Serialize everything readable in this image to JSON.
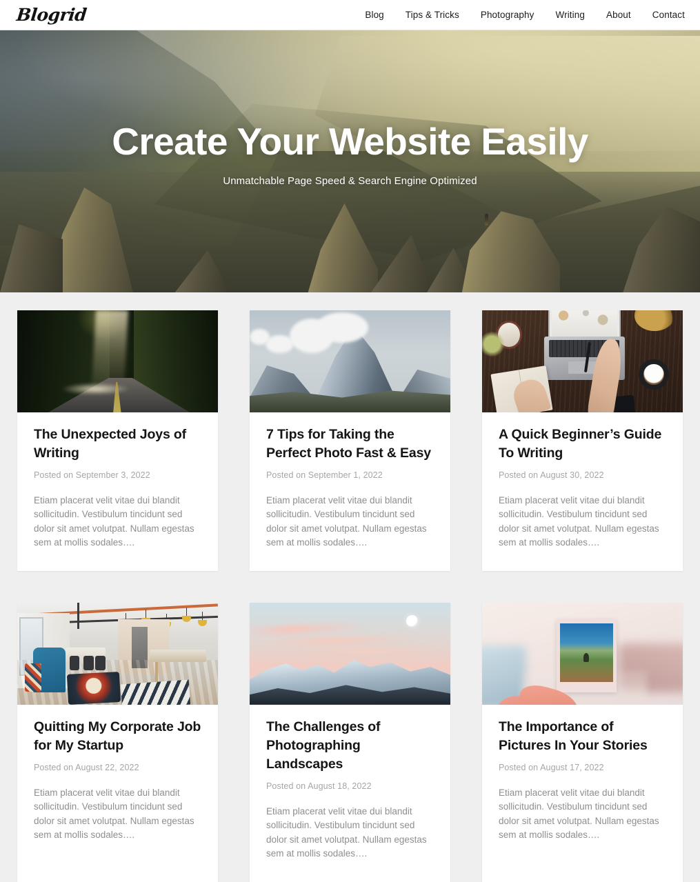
{
  "header": {
    "logo": "Blogrid",
    "nav": [
      {
        "label": "Blog"
      },
      {
        "label": "Tips & Tricks"
      },
      {
        "label": "Photography"
      },
      {
        "label": "Writing"
      },
      {
        "label": "About"
      },
      {
        "label": "Contact"
      }
    ]
  },
  "hero": {
    "title": "Create Your Website Easily",
    "subtitle": "Unmatchable Page Speed & Search Engine Optimized",
    "image_alt": "mountain-valley-landscape-with-rock-spires-and-hiker"
  },
  "posts": [
    {
      "title": "The Unexpected Joys of Writing",
      "date": "Posted on September 3, 2022",
      "excerpt": "Etiam placerat velit vitae dui blandit sollicitudin. Vestibulum tincidunt sed dolor sit amet volutpat. Nullam egestas sem at mollis sodales….",
      "image_alt": "sunbeam-on-forest-road"
    },
    {
      "title": "7 Tips for Taking the Perfect Photo Fast & Easy",
      "date": "Posted on September 1, 2022",
      "excerpt": "Etiam placerat velit vitae dui blandit sollicitudin. Vestibulum tincidunt sed dolor sit amet volutpat. Nullam egestas sem at mollis sodales….",
      "image_alt": "matterhorn-peak-with-clouds"
    },
    {
      "title": "A Quick Beginner’s Guide To Writing",
      "date": "Posted on August 30, 2022",
      "excerpt": "Etiam placerat velit vitae dui blandit sollicitudin. Vestibulum tincidunt sed dolor sit amet volutpat. Nullam egestas sem at mollis sodales….",
      "image_alt": "overhead-desk-with-laptop-and-coffee"
    },
    {
      "title": "Quitting My Corporate Job for My Startup",
      "date": "Posted on August 22, 2022",
      "excerpt": "Etiam placerat velit vitae dui blandit sollicitudin. Vestibulum tincidunt sed dolor sit amet volutpat. Nullam egestas sem at mollis sodales….",
      "image_alt": "industrial-coworking-office-interior"
    },
    {
      "title": "The Challenges of Photographing Landscapes",
      "date": "Posted on August 18, 2022",
      "excerpt": "Etiam placerat velit vitae dui blandit sollicitudin. Vestibulum tincidunt sed dolor sit amet volutpat. Nullam egestas sem at mollis sodales….",
      "image_alt": "snowy-mountain-range-at-dusk-with-moon"
    },
    {
      "title": "The Importance of Pictures In Your Stories",
      "date": "Posted on August 17, 2022",
      "excerpt": "Etiam placerat velit vitae dui blandit sollicitudin. Vestibulum tincidunt sed dolor sit amet volutpat. Nullam egestas sem at mollis sodales….",
      "image_alt": "hand-holding-polaroid-photo-of-field"
    }
  ],
  "colors": {
    "page_background": "#efefef",
    "card_background": "#ffffff",
    "header_background": "#ffffff",
    "title_text": "#151515",
    "muted_text": "#8e8e8e",
    "date_text": "#a6a6a6",
    "hero_text": "#ffffff"
  }
}
